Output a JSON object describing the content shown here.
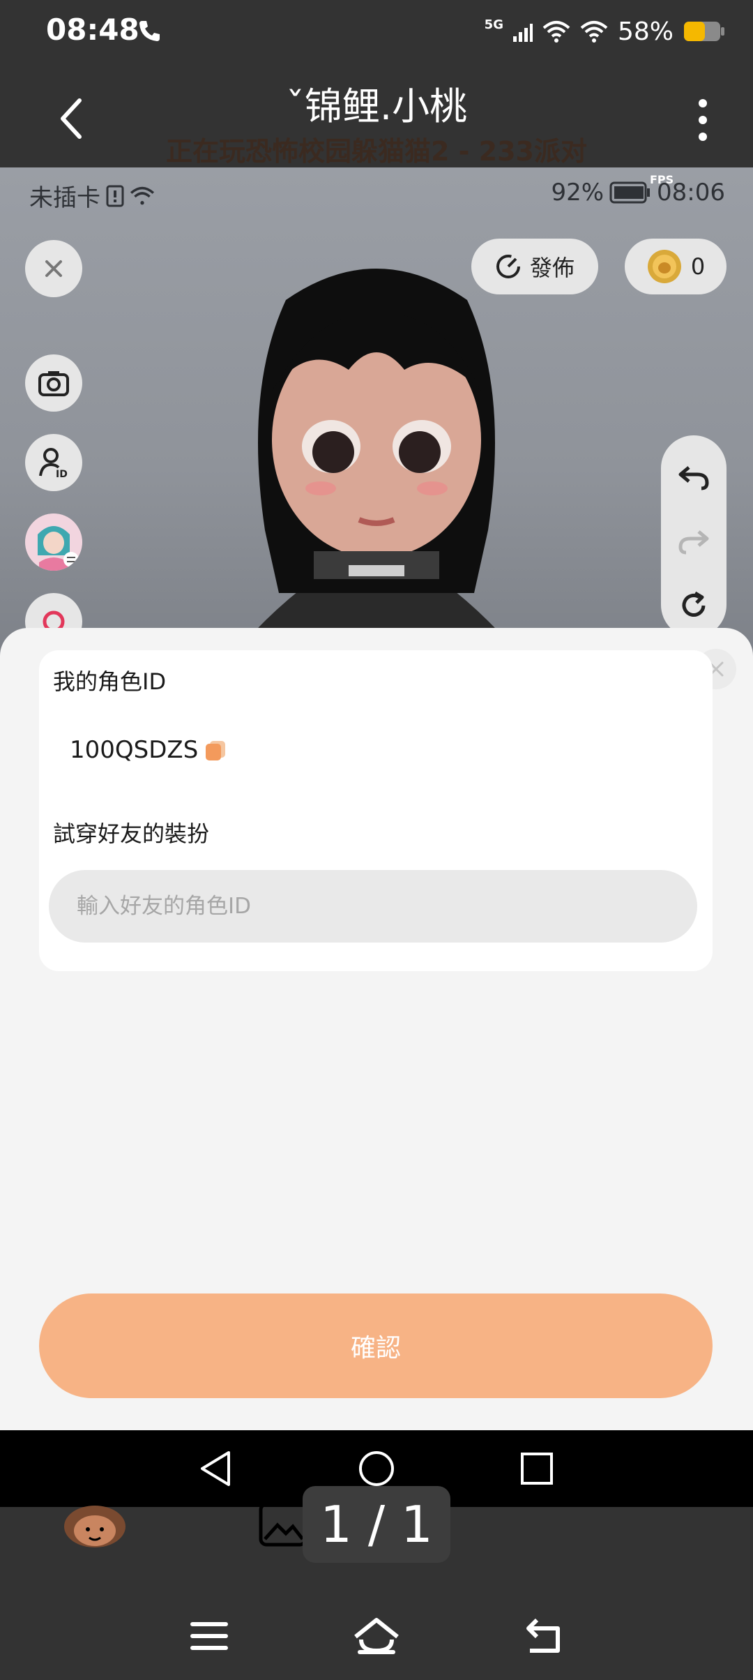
{
  "status_bar": {
    "time": "08:48",
    "network": "5G",
    "battery": "58%"
  },
  "header": {
    "title": "ˇ锦鲤.小桃",
    "subtitle": "正在玩恐怖校园躲猫猫2 - 233派对"
  },
  "inner_status": {
    "carrier": "未插卡",
    "battery": "92%",
    "time": "08:06",
    "fps": "FPS"
  },
  "toolbar": {
    "publish_label": "發佈",
    "coins": "0"
  },
  "sheet": {
    "my_id_label": "我的角色ID",
    "my_id_value": "100QSDZS",
    "try_label": "試穿好友的裝扮",
    "input_placeholder": "輸入好友的角色ID",
    "confirm_label": "確認"
  },
  "viewer": {
    "page_indicator": "1 / 1"
  },
  "colors": {
    "accent": "#f7b385",
    "sheet_bg": "#f4f4f4",
    "dark_bg": "#333333"
  }
}
